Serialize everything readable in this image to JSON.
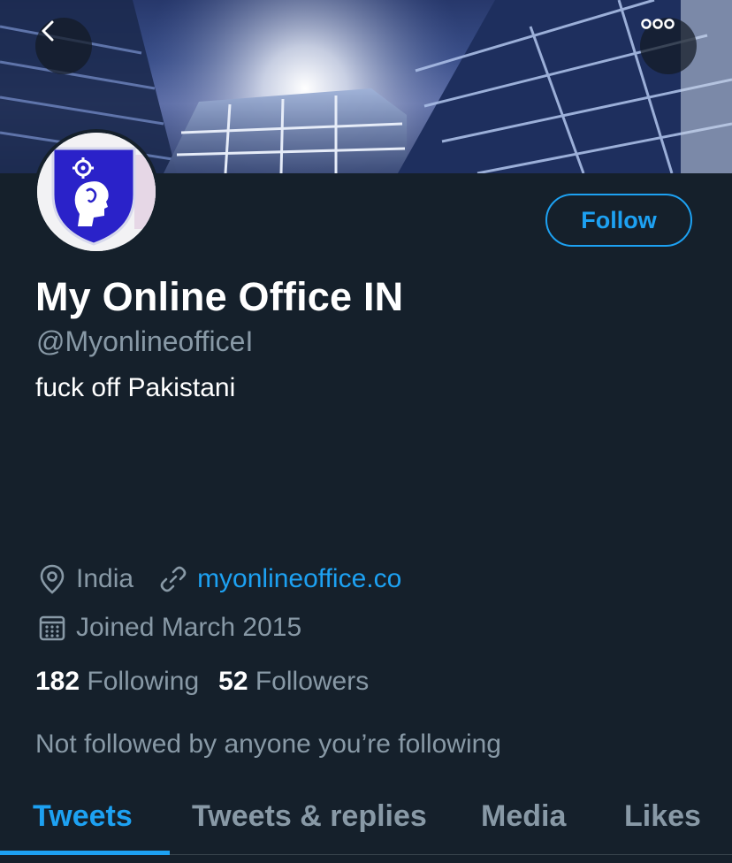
{
  "colors": {
    "background": "#15202b",
    "accent": "#1da1f2",
    "secondary_text": "#8899a6",
    "primary_text": "#ffffff"
  },
  "header": {
    "back_icon": "chevron-left-icon",
    "more_icon": "more-icon"
  },
  "profile": {
    "follow_label": "Follow",
    "display_name": "My Online Office IN",
    "handle": "@MyonlineofficeI",
    "bio": "fuck off Pakistani",
    "location": "India",
    "location_icon": "location-pin-icon",
    "website": "myonlineoffice.co",
    "website_icon": "link-icon",
    "joined": "Joined March 2015",
    "joined_icon": "calendar-icon",
    "following_count": "182",
    "following_label": "Following",
    "followers_count": "52",
    "followers_label": "Followers",
    "not_followed_text": "Not followed by anyone you’re following"
  },
  "tabs": [
    {
      "label": "Tweets",
      "active": true
    },
    {
      "label": "Tweets & replies",
      "active": false
    },
    {
      "label": "Media",
      "active": false
    },
    {
      "label": "Likes",
      "active": false
    }
  ]
}
